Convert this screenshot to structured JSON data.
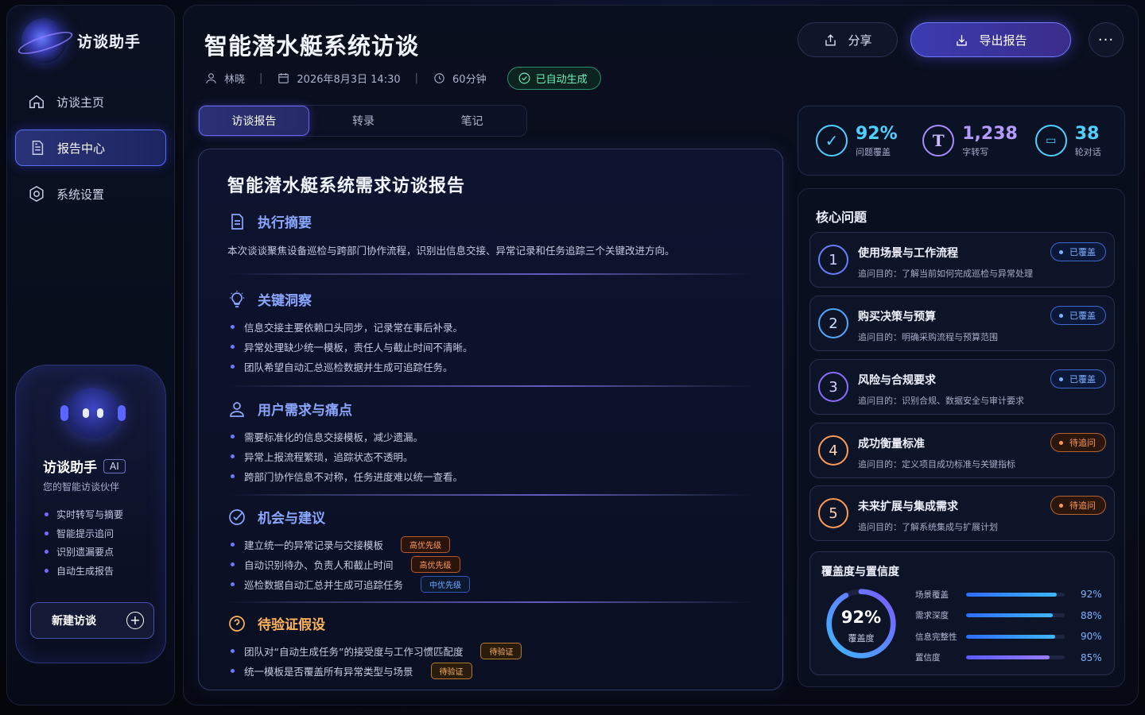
{
  "app": {
    "title": "访谈助手"
  },
  "nav": [
    {
      "label": "访谈主页",
      "icon": "home-icon"
    },
    {
      "label": "报告中心",
      "icon": "document-icon",
      "active": true
    },
    {
      "label": "系统设置",
      "icon": "settings-icon"
    }
  ],
  "assistant": {
    "title": "访谈助手",
    "badge": "AI",
    "subtitle": "您的智能访谈伙伴",
    "features": [
      "实时转写与摘要",
      "智能提示追问",
      "识别遗漏要点",
      "自动生成报告"
    ],
    "new_button": "新建访谈"
  },
  "header": {
    "title": "智能潜水艇系统访谈",
    "person": "林晓",
    "datetime": "2026年8月3日 14:30",
    "duration": "60分钟",
    "status": "已自动生成",
    "share": "分享",
    "export": "导出报告",
    "more": "···"
  },
  "tabs": [
    {
      "label": "访谈报告",
      "active": true
    },
    {
      "label": "转录"
    },
    {
      "label": "笔记"
    }
  ],
  "report": {
    "title": "智能潜水艇系统需求访谈报告",
    "summary": {
      "heading": "执行摘要",
      "text": "本次谈谈聚焦设备巡检与跨部门协作流程，识别出信息交接、异常记录和任务追踪三个关键改进方向。"
    },
    "insights": {
      "heading": "关键洞察",
      "items": [
        "信息交接主要依赖口头同步，记录常在事后补录。",
        "异常处理缺少统一模板，责任人与截止时间不清晰。",
        "团队希望自动汇总巡检数据并生成可追踪任务。"
      ]
    },
    "needs": {
      "heading": "用户需求与痛点",
      "items": [
        "需要标准化的信息交接模板，减少遗漏。",
        "异常上报流程繁琐，追踪状态不透明。",
        "跨部门协作信息不对称，任务进度难以统一查看。"
      ]
    },
    "opportunities": {
      "heading": "机会与建议",
      "items": [
        {
          "text": "建立统一的异常记录与交接模板",
          "tag": "高优先级",
          "level": "hi"
        },
        {
          "text": "自动识别待办、负责人和截止时间",
          "tag": "高优先级",
          "level": "hi"
        },
        {
          "text": "巡检数据自动汇总并生成可追踪任务",
          "tag": "中优先级",
          "level": "mid"
        }
      ]
    },
    "hypotheses": {
      "heading": "待验证假设",
      "items": [
        {
          "text": "团队对“自动生成任务”的接受度与工作习惯匹配度",
          "tag": "待验证"
        },
        {
          "text": "统一模板是否覆盖所有异常类型与场景",
          "tag": "待验证"
        }
      ]
    }
  },
  "stats": [
    {
      "value": "92%",
      "label": "问题覆盖",
      "icon": "check-circle-icon",
      "color": "#4fd0ff"
    },
    {
      "value": "1,238",
      "label": "字转写",
      "icon": "text-t-icon",
      "color": "#a78bff"
    },
    {
      "value": "38",
      "label": "轮对话",
      "icon": "chat-icon",
      "color": "#4fd0ff"
    }
  ],
  "issues_title": "核心问题",
  "issues": [
    {
      "num": "1",
      "name": "使用场景与工作流程",
      "purpose": "追问目的：了解当前如何完成巡检与异常处理",
      "status": "已覆盖",
      "state": "ok"
    },
    {
      "num": "2",
      "name": "购买决策与预算",
      "purpose": "追问目的：明确采购流程与预算范围",
      "status": "已覆盖",
      "state": "ok"
    },
    {
      "num": "3",
      "name": "风险与合规要求",
      "purpose": "追问目的：识别合规、数据安全与审计要求",
      "status": "已覆盖",
      "state": "ok"
    },
    {
      "num": "4",
      "name": "成功衡量标准",
      "purpose": "追问目的：定义项目成功标准与关键指标",
      "status": "待追问",
      "state": "pend"
    },
    {
      "num": "5",
      "name": "未来扩展与集成需求",
      "purpose": "追问目的：了解系统集成与扩展计划",
      "status": "待追问",
      "state": "pend"
    }
  ],
  "coverage": {
    "title": "覆盖度与置信度",
    "donut_value": "92%",
    "donut_fraction": 0.92,
    "donut_label": "覆盖度",
    "bars": [
      {
        "label": "场景覆盖",
        "value": "92%",
        "fraction": 0.92
      },
      {
        "label": "需求深度",
        "value": "88%",
        "fraction": 0.88
      },
      {
        "label": "信息完整性",
        "value": "90%",
        "fraction": 0.9
      },
      {
        "label": "置信度",
        "value": "85%",
        "fraction": 0.85
      }
    ]
  }
}
